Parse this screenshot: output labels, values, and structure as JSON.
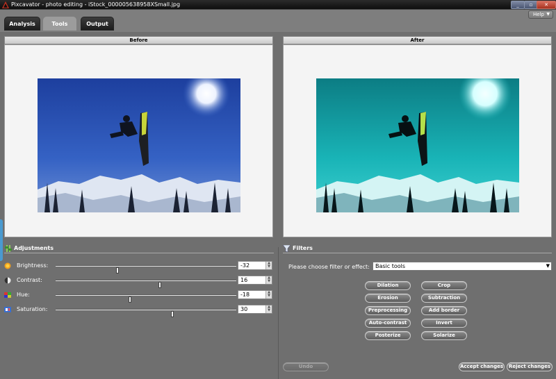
{
  "window": {
    "title": "Pixcavator - photo editing - iStock_000005638958XSmall.jpg",
    "controls": [
      "_",
      "▫",
      "✕"
    ]
  },
  "tabs": [
    {
      "label": "Analysis",
      "active": false
    },
    {
      "label": "Tools",
      "active": true
    },
    {
      "label": "Output",
      "active": false
    }
  ],
  "help": {
    "label": "Help"
  },
  "panels": {
    "before": {
      "title": "Before"
    },
    "after": {
      "title": "After"
    }
  },
  "adjustments": {
    "title": "Adjustments",
    "items": [
      {
        "label": "Brightness:",
        "value": "-32",
        "icon": "sun-icon",
        "level": 0.34
      },
      {
        "label": "Contrast:",
        "value": "16",
        "icon": "contrast-icon",
        "level": 0.58
      },
      {
        "label": "Hue:",
        "value": "-18",
        "icon": "hue-icon",
        "level": 0.41
      },
      {
        "label": "Saturation:",
        "value": "30",
        "icon": "saturation-icon",
        "level": 0.65
      }
    ]
  },
  "filters": {
    "title": "Filters",
    "choose_label": "Please choose filter or effect:",
    "selected": "Basic tools",
    "buttons": [
      [
        "Dilation",
        "Crop"
      ],
      [
        "Erosion",
        "Subtraction"
      ],
      [
        "Preprocessing",
        "Add border"
      ],
      [
        "Auto-contrast",
        "Invert"
      ],
      [
        "Posterize",
        "Solarize"
      ]
    ]
  },
  "footer": {
    "undo": "Undo",
    "accept": "Accept changes",
    "reject": "Reject changes"
  },
  "colors": {
    "accent": "#c03020",
    "before_sky": "#2e56b8",
    "after_sky": "#1fb6b6"
  }
}
